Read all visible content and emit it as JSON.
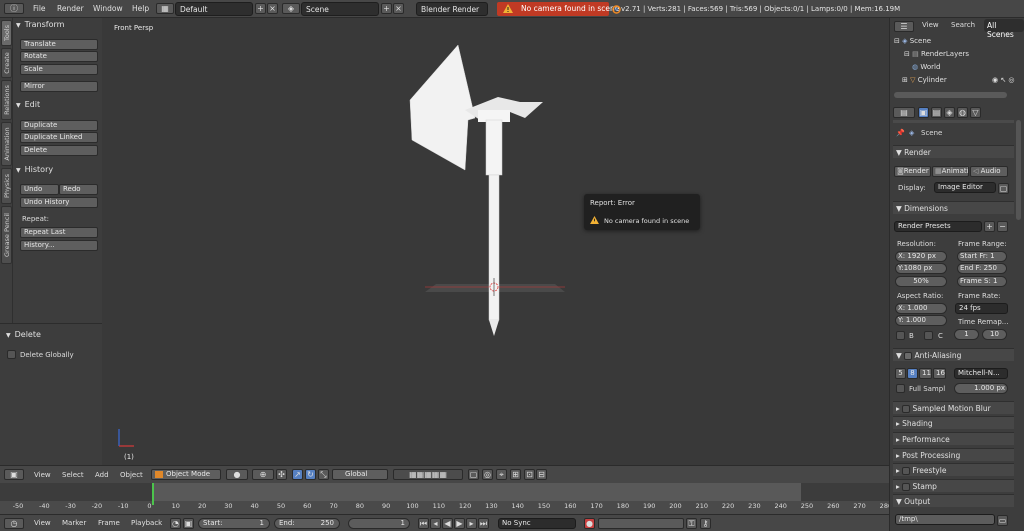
{
  "topbar": {
    "menus": [
      "File",
      "Render",
      "Window",
      "Help"
    ],
    "screen_layout": "Default",
    "scene": "Scene",
    "render_engine": "Blender Render",
    "error_message": "No camera found in scene",
    "stats": "v2.71 | Verts:281 | Faces:569 | Tris:569 | Objects:0/1 | Lamps:0/0 | Mem:16.19M"
  },
  "tool_tabs": [
    "Tools",
    "Create",
    "Relations",
    "Animation",
    "Physics",
    "Grease Pencil"
  ],
  "tools": {
    "transform_header": "Transform",
    "translate": "Translate",
    "rotate": "Rotate",
    "scale": "Scale",
    "mirror": "Mirror",
    "edit_header": "Edit",
    "duplicate": "Duplicate",
    "duplicate_linked": "Duplicate Linked",
    "delete": "Delete",
    "history_header": "History",
    "undo": "Undo",
    "redo": "Redo",
    "undo_history": "Undo History",
    "repeat_label": "Repeat:",
    "repeat_last": "Repeat Last",
    "history": "History..."
  },
  "operator_panel": {
    "header": "Delete",
    "delete_globally": "Delete Globally"
  },
  "viewport": {
    "title": "Front Persp",
    "frame_label": "(1)",
    "report_title": "Report: Error",
    "report_message": "No camera found in scene"
  },
  "view_header": {
    "menus": [
      "View",
      "Select",
      "Add",
      "Object"
    ],
    "mode": "Object Mode",
    "orientation": "Global"
  },
  "timeline": {
    "ticks": [
      "-50",
      "-40",
      "-30",
      "-20",
      "-10",
      "0",
      "10",
      "20",
      "30",
      "40",
      "50",
      "60",
      "70",
      "80",
      "90",
      "100",
      "110",
      "120",
      "130",
      "140",
      "150",
      "160",
      "170",
      "180",
      "190",
      "200",
      "210",
      "220",
      "230",
      "240",
      "250",
      "260",
      "270",
      "280"
    ],
    "menus": [
      "View",
      "Marker",
      "Frame",
      "Playback"
    ],
    "start_label": "Start:",
    "start_value": "1",
    "end_label": "End:",
    "end_value": "250",
    "current_frame": "1",
    "sync": "No Sync"
  },
  "outliner": {
    "view": "View",
    "search": "Search",
    "filter": "All Scenes",
    "rows": [
      "Scene",
      "RenderLayers",
      "World",
      "Cylinder"
    ]
  },
  "properties": {
    "context": "Scene",
    "render": {
      "header": "Render",
      "render_btn": "Render",
      "animation_btn": "Animati",
      "audio_btn": "Audio",
      "display_label": "Display:",
      "display_value": "Image Editor"
    },
    "dimensions": {
      "header": "Dimensions",
      "presets": "Render Presets",
      "resolution_label": "Resolution:",
      "res_x": "X: 1920 px",
      "res_y": "Y:1080 px",
      "res_pct": "50%",
      "frame_range_label": "Frame Range:",
      "start_frame": "Start Fr: 1",
      "end_frame": "End F: 250",
      "frame_step": "Frame S: 1",
      "aspect_label": "Aspect Ratio:",
      "aspect_x": "X: 1.000",
      "aspect_y": "Y: 1.000",
      "frame_rate_label": "Frame Rate:",
      "frame_rate": "24 fps",
      "time_remap_label": "Time Remap...",
      "remap_old": "1",
      "remap_new": "10",
      "border_b": "B",
      "border_c": "C"
    },
    "antialiasing": {
      "header": "Anti-Aliasing",
      "samples": [
        "5",
        "8",
        "11",
        "16"
      ],
      "selected_sample": "8",
      "filter": "Mitchell-N...",
      "full_sample": "Full Sampl",
      "filter_size": "1.000 px"
    },
    "collapsed_panels": [
      "Sampled Motion Blur",
      "Shading",
      "Performance",
      "Post Processing",
      "Freestyle",
      "Stamp"
    ],
    "output": {
      "header": "Output",
      "path": "/tmp\\"
    }
  },
  "colors": {
    "error_badge": "#c03a24",
    "accent_blue": "#5680c2",
    "timeline_cursor": "#4cc44c"
  }
}
